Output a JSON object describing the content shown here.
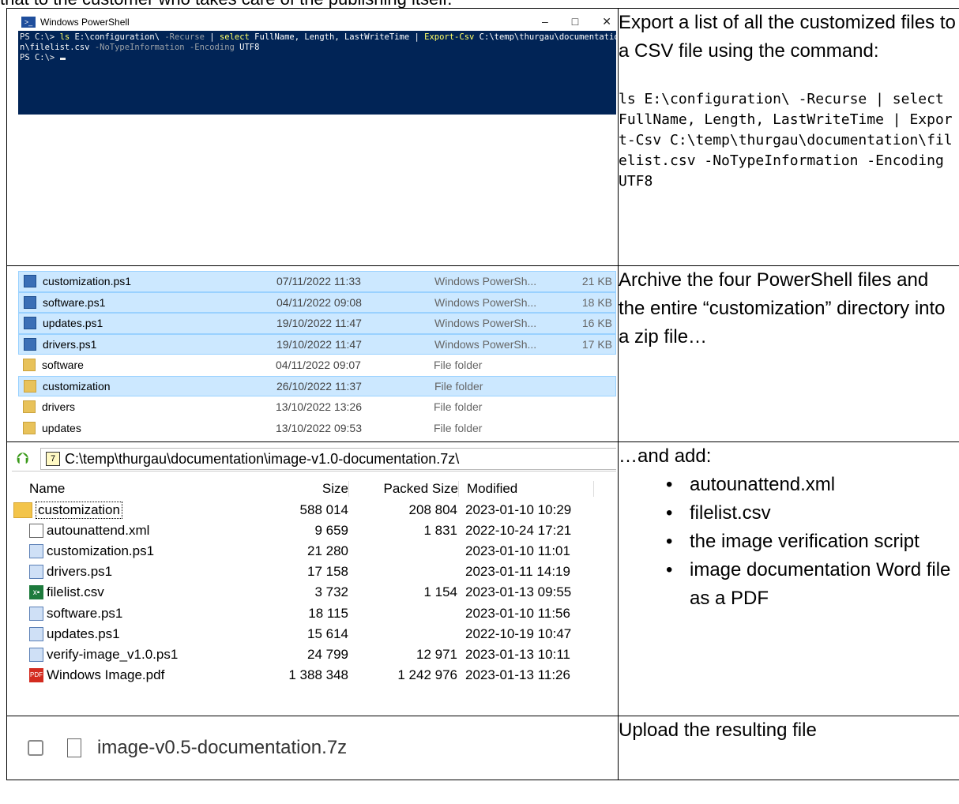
{
  "top_text": "that to the customer who takes care of the publishing itself.",
  "row1": {
    "ps_title": "Windows PowerShell",
    "ps_ctrls": [
      "–",
      "□",
      "✕"
    ],
    "ps_line1_prompt": "PS C:\\> ",
    "ps_line1_cmd": "ls ",
    "ps_line1_path": "E:\\configuration\\ ",
    "ps_line1_flag": "-Recurse ",
    "ps_line1_pipe1": "| ",
    "ps_line1_select": "select ",
    "ps_line1_fields": "FullName, Length, LastWriteTime ",
    "ps_line1_pipe2": "| ",
    "ps_line1_export": "Export-Csv ",
    "ps_line1_dest": "C:\\temp\\thurgau\\documentatio",
    "ps_line2_dest": "n\\filelist.csv ",
    "ps_line2_flags": "-NoTypeInformation -Encoding ",
    "ps_line2_enc": "UTF8",
    "ps_line3_prompt": "PS C:\\> ",
    "text": "Export a list of all the customized files to a CSV file using the command:",
    "command": "ls E:\\configuration\\ -Recurse | select FullName, Length, LastWriteTime | Export-Csv C:\\temp\\thurgau\\documentation\\filelist.csv -NoTypeInformation -Encoding UTF8"
  },
  "row2": {
    "files": [
      {
        "name": "customization.ps1",
        "date": "07/11/2022 11:33",
        "type": "Windows PowerSh...",
        "size": "21 KB",
        "selected": true,
        "icon": "powershell-file-icon"
      },
      {
        "name": "software.ps1",
        "date": "04/11/2022 09:08",
        "type": "Windows PowerSh...",
        "size": "18 KB",
        "selected": true,
        "icon": "powershell-file-icon"
      },
      {
        "name": "updates.ps1",
        "date": "19/10/2022 11:47",
        "type": "Windows PowerSh...",
        "size": "16 KB",
        "selected": true,
        "icon": "powershell-file-icon"
      },
      {
        "name": "drivers.ps1",
        "date": "19/10/2022 11:47",
        "type": "Windows PowerSh...",
        "size": "17 KB",
        "selected": true,
        "icon": "powershell-file-icon"
      },
      {
        "name": "software",
        "date": "04/11/2022 09:07",
        "type": "File folder",
        "size": "",
        "selected": false,
        "icon": "folder-icon"
      },
      {
        "name": "customization",
        "date": "26/10/2022 11:37",
        "type": "File folder",
        "size": "",
        "selected": true,
        "icon": "folder-icon"
      },
      {
        "name": "drivers",
        "date": "13/10/2022 13:26",
        "type": "File folder",
        "size": "",
        "selected": false,
        "icon": "folder-icon"
      },
      {
        "name": "updates",
        "date": "13/10/2022 09:53",
        "type": "File folder",
        "size": "",
        "selected": false,
        "icon": "folder-icon"
      }
    ],
    "text": "Archive the four PowerShell files and the entire “customization” directory into a zip file…"
  },
  "row3": {
    "path": "C:\\temp\\thurgau\\documentation\\image-v1.0-documentation.7z\\",
    "headers": {
      "name": "Name",
      "size": "Size",
      "packed": "Packed Size",
      "modified": "Modified"
    },
    "files": [
      {
        "name": "customization",
        "size": "588 014",
        "packed": "208 804",
        "modified": "2023-01-10 10:29",
        "icon": "folder"
      },
      {
        "name": "autounattend.xml",
        "size": "9 659",
        "packed": "1 831",
        "modified": "2022-10-24 17:21",
        "icon": "doc"
      },
      {
        "name": "customization.ps1",
        "size": "21 280",
        "packed": "",
        "modified": "2023-01-10 11:01",
        "icon": "ps"
      },
      {
        "name": "drivers.ps1",
        "size": "17 158",
        "packed": "",
        "modified": "2023-01-11 14:19",
        "icon": "ps"
      },
      {
        "name": "filelist.csv",
        "size": "3 732",
        "packed": "1 154",
        "modified": "2023-01-13 09:55",
        "icon": "xl"
      },
      {
        "name": "software.ps1",
        "size": "18 115",
        "packed": "",
        "modified": "2023-01-10 11:56",
        "icon": "ps"
      },
      {
        "name": "updates.ps1",
        "size": "15 614",
        "packed": "",
        "modified": "2022-10-19 10:47",
        "icon": "ps"
      },
      {
        "name": "verify-image_v1.0.ps1",
        "size": "24 799",
        "packed": "12 971",
        "modified": "2023-01-13 10:11",
        "icon": "ps"
      },
      {
        "name": "Windows Image.pdf",
        "size": "1 388 348",
        "packed": "1 242 976",
        "modified": "2023-01-13 11:26",
        "icon": "pdf"
      }
    ],
    "text": "…and add:",
    "bullets": [
      "autounattend.xml",
      "filelist.csv",
      "the image verification script",
      "image documentation Word file as a PDF"
    ],
    "icon_labels": {
      "xl": "x▪",
      "pdf": "PDF",
      "box": "7"
    }
  },
  "row4": {
    "file": "image-v0.5-documentation.7z",
    "text": "Upload the resulting file"
  }
}
